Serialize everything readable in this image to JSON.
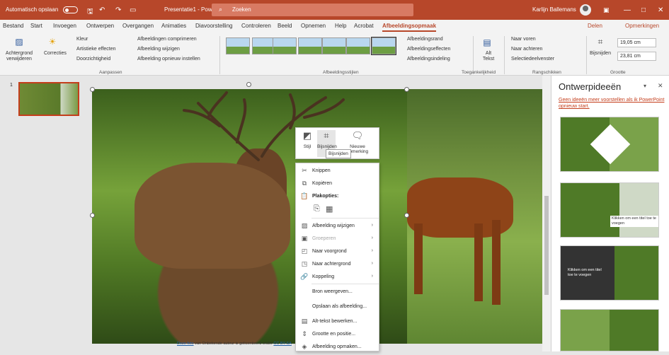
{
  "titlebar": {
    "autosave": "Automatisch opslaan",
    "toggle": "Uit",
    "file": "Presentatie1 - PowerPoint",
    "search": "Zoeken",
    "user": "Karlijn Ballemans"
  },
  "tabs": [
    "Bestand",
    "Start",
    "Invoegen",
    "Ontwerpen",
    "Overgangen",
    "Animaties",
    "Diavoorstelling",
    "Controleren",
    "Beeld",
    "Opnemen",
    "Help",
    "Acrobat",
    "Afbeeldingsopmaak"
  ],
  "share": "Delen",
  "comments": "Opmerkingen",
  "ribbon": {
    "bg_remove": "Achtergrond verwijderen",
    "corrections": "Correcties",
    "color": "Kleur",
    "artistic": "Artistieke effecten",
    "transparency": "Doorzichtigheid",
    "compress": "Afbeeldingen comprimeren",
    "change": "Afbeelding wijzigen",
    "reset": "Afbeelding opnieuw instellen",
    "group_adjust": "Aanpassen",
    "group_styles": "Afbeeldingsstijlen",
    "border": "Afbeeldingsrand",
    "effects": "Afbeeldingseffecten",
    "layout": "Afbeeldingsindeling",
    "alt": "Alt Tekst",
    "group_access": "Toegankelijkheid",
    "forward": "Naar voren",
    "backward": "Naar achteren",
    "selpane": "Selectiedeelvenster",
    "group_arrange": "Rangschikken",
    "crop": "Bijsnijden",
    "height": "19,05 cm",
    "width": "23,81 cm",
    "group_size": "Grootte"
  },
  "slide_number": "1",
  "credit": {
    "pre": "Deze foto",
    "mid": "van Onbekende auteur is gelicentieerd onder",
    "link": "CC BY-SA"
  },
  "minibar": {
    "style": "Stijl",
    "crop": "Bijsnijden",
    "new": "Nieuwe opmerking",
    "tooltip": "Bijsnijden"
  },
  "context": {
    "cut": "Knippen",
    "copy": "Kopiëren",
    "paste_opts": "Plakopties:",
    "change_pic": "Afbeelding wijzigen",
    "group": "Groeperen",
    "front": "Naar voorgrond",
    "back": "Naar achtergrond",
    "link": "Koppeling",
    "source": "Bron weergeven...",
    "save": "Opslaan als afbeelding...",
    "alt": "Alt-tekst bewerken...",
    "size": "Grootte en positie...",
    "format": "Afbeelding opmaken..."
  },
  "design": {
    "title": "Ontwerpideeën",
    "message": "Geen ideeën meer voorstellen als ik PowerPoint opnieuw start.",
    "caption": "Klikken om een titel toe te voegen"
  }
}
